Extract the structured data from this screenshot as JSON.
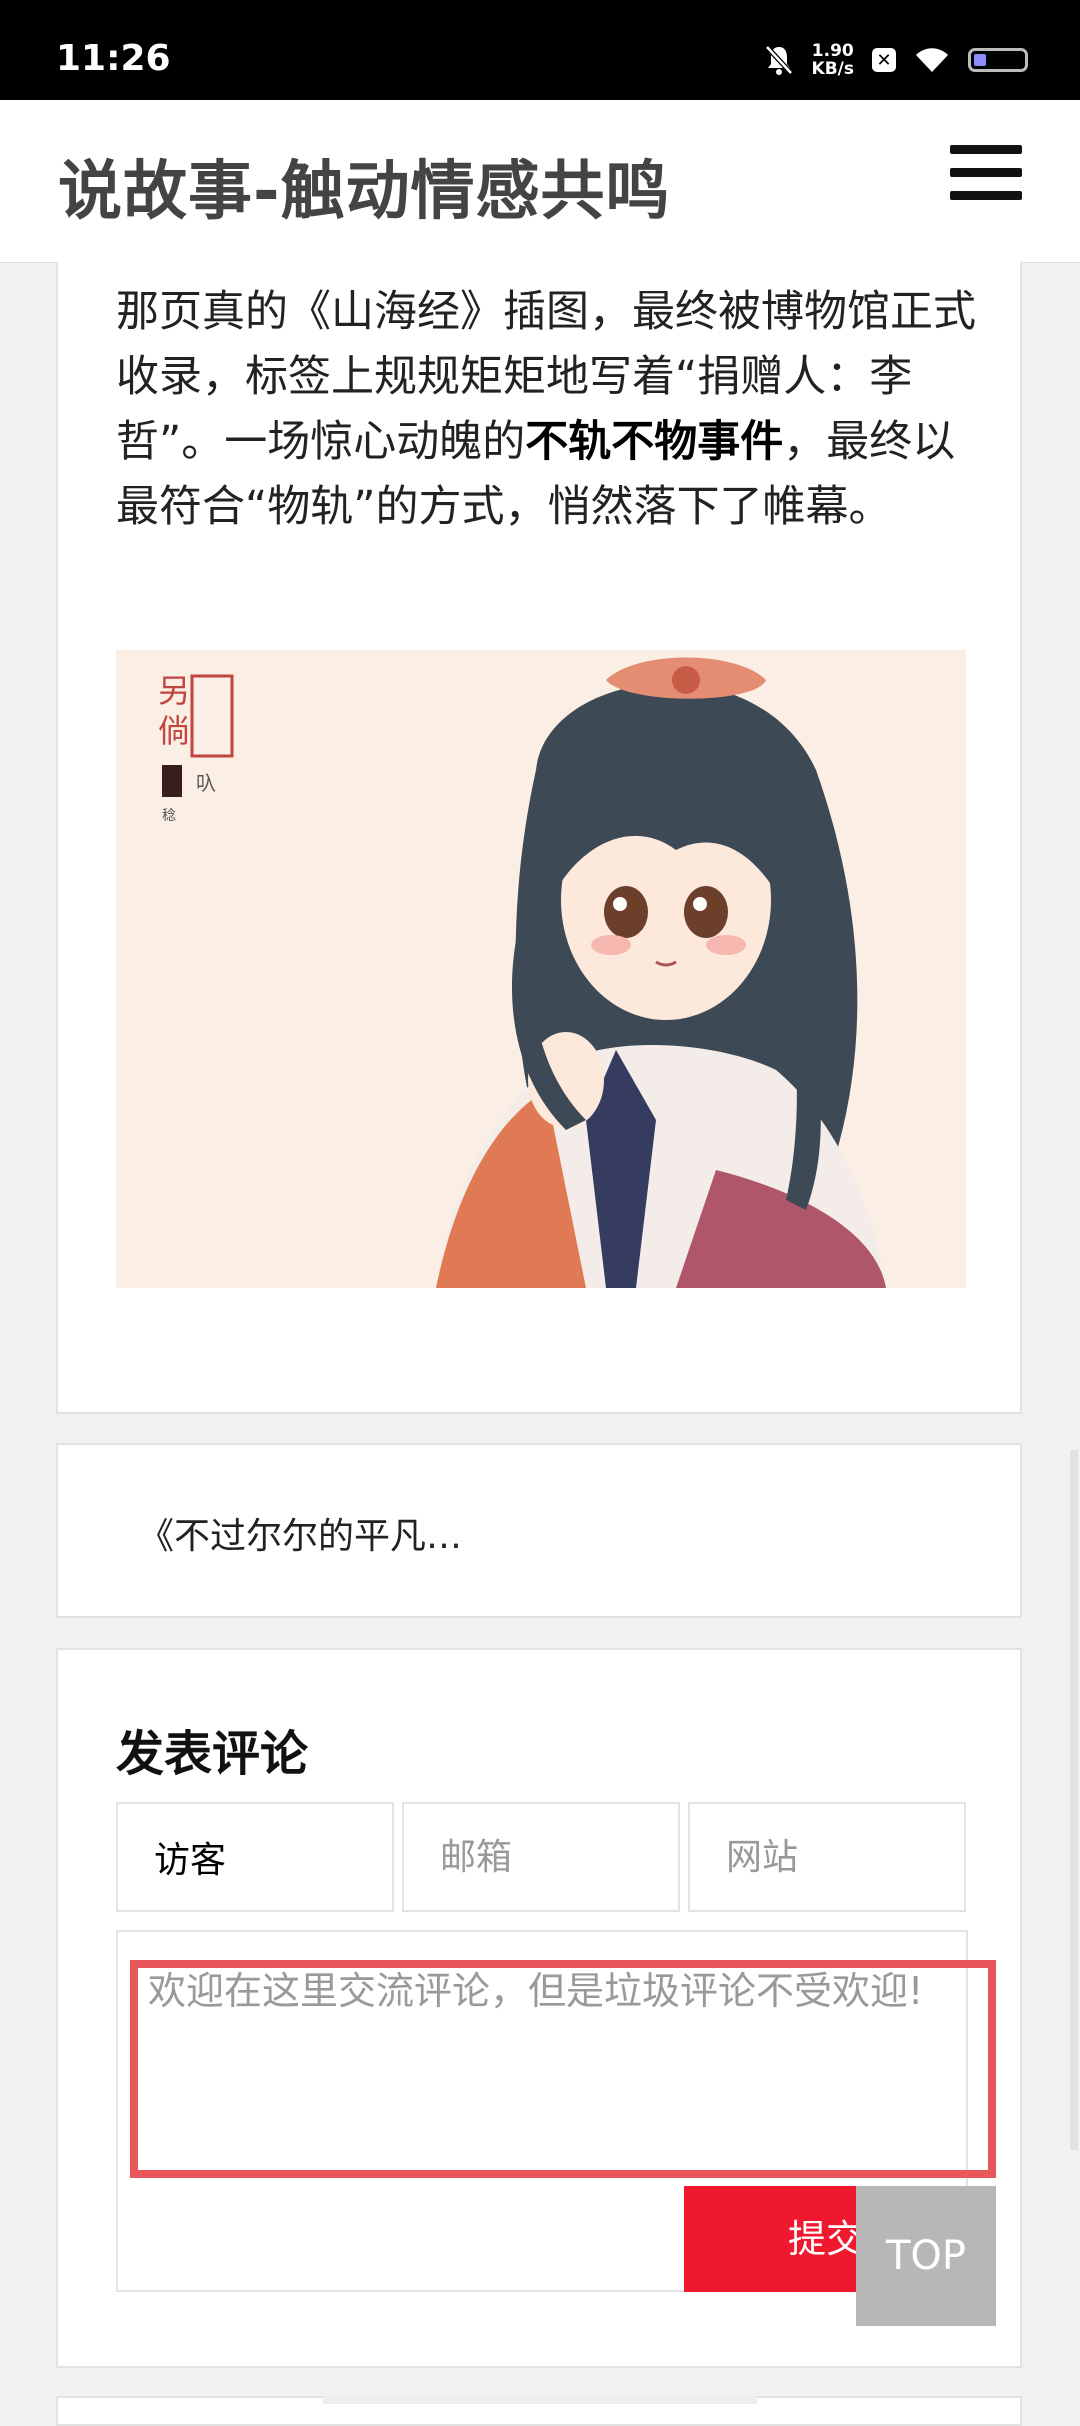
{
  "status": {
    "time": "11:26",
    "net_speed_value": "1.90",
    "net_speed_unit": "KB/s"
  },
  "header": {
    "site_title": "说故事-触动情感共鸣",
    "menu_icon": "hamburger-menu-icon"
  },
  "article": {
    "paragraph_part1": "那页真的《山海经》插图，最终被博物馆正式收录，标签上规规矩矩地写着“捐赠人：李哲”。一场惊心动魄的",
    "paragraph_bold": "不轨不物事件",
    "paragraph_part2": "，最终以最符合“物轨”的方式，悄然落下了帷幕。",
    "image_stamp_text": "另倘"
  },
  "navigation": {
    "prev_post_label": "《不过尔尔的平凡…"
  },
  "comment_form": {
    "title": "发表评论",
    "name_value": "访客",
    "email_placeholder": "邮箱",
    "website_placeholder": "网站",
    "comment_placeholder": "欢迎在这里交流评论，但是垃圾评论不受欢迎!",
    "submit_label": "提交"
  },
  "back_to_top_label": "TOP",
  "colors": {
    "submit_red": "#f0182f",
    "highlight_red": "#e8585a",
    "top_button_gray": "#b7b7b7"
  }
}
